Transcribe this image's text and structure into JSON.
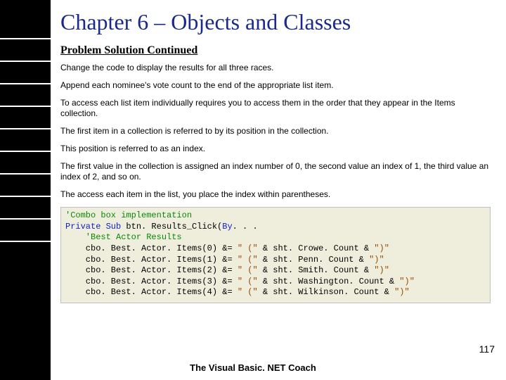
{
  "title": "Chapter 6 – Objects and Classes",
  "subtitle": "Problem Solution Continued",
  "paragraphs": [
    "Change the code to display the results for all three races.",
    "Append each nominee's vote count to the end of the appropriate list item.",
    "To access each list item individually requires you to access them in the order that they appear in the Items collection.",
    "The first item in a collection is referred to by its position in the collection.",
    "This position is referred to as an index.",
    "The first value in the collection is assigned an index number of 0, the second value an index of 1, the third value an index of 2, and so on.",
    "The access each item in the list, you place the index within parentheses."
  ],
  "code": {
    "l0_green": "'Combo box implementation",
    "l1_blue": "Private Sub ",
    "l1_rest": "btn. Results_Click(",
    "l1_blue2": "By",
    "l1_tail": ". . .",
    "l2_green": "    'Best Actor Results",
    "rows": [
      {
        "lhs": "    cbo. Best. Actor. Items(0) &= ",
        "mid": "\" (\"",
        "amp": " & ",
        "fn": "sht. Crowe. Count & ",
        "end": "\")\""
      },
      {
        "lhs": "    cbo. Best. Actor. Items(1) &= ",
        "mid": "\" (\"",
        "amp": " & ",
        "fn": "sht. Penn. Count & ",
        "end": "\")\""
      },
      {
        "lhs": "    cbo. Best. Actor. Items(2) &= ",
        "mid": "\" (\"",
        "amp": " & ",
        "fn": "sht. Smith. Count & ",
        "end": "\")\""
      },
      {
        "lhs": "    cbo. Best. Actor. Items(3) &= ",
        "mid": "\" (\"",
        "amp": " & ",
        "fn": "sht. Washington. Count & ",
        "end": "\")\""
      },
      {
        "lhs": "    cbo. Best. Actor. Items(4) &= ",
        "mid": "\" (\"",
        "amp": " & ",
        "fn": "sht. Wilkinson. Count & ",
        "end": "\")\""
      }
    ]
  },
  "page_number": "117",
  "footer": "The Visual Basic. NET Coach",
  "stripe_positions": [
    54,
    86,
    118,
    150,
    182,
    214,
    246,
    278,
    310,
    342
  ]
}
